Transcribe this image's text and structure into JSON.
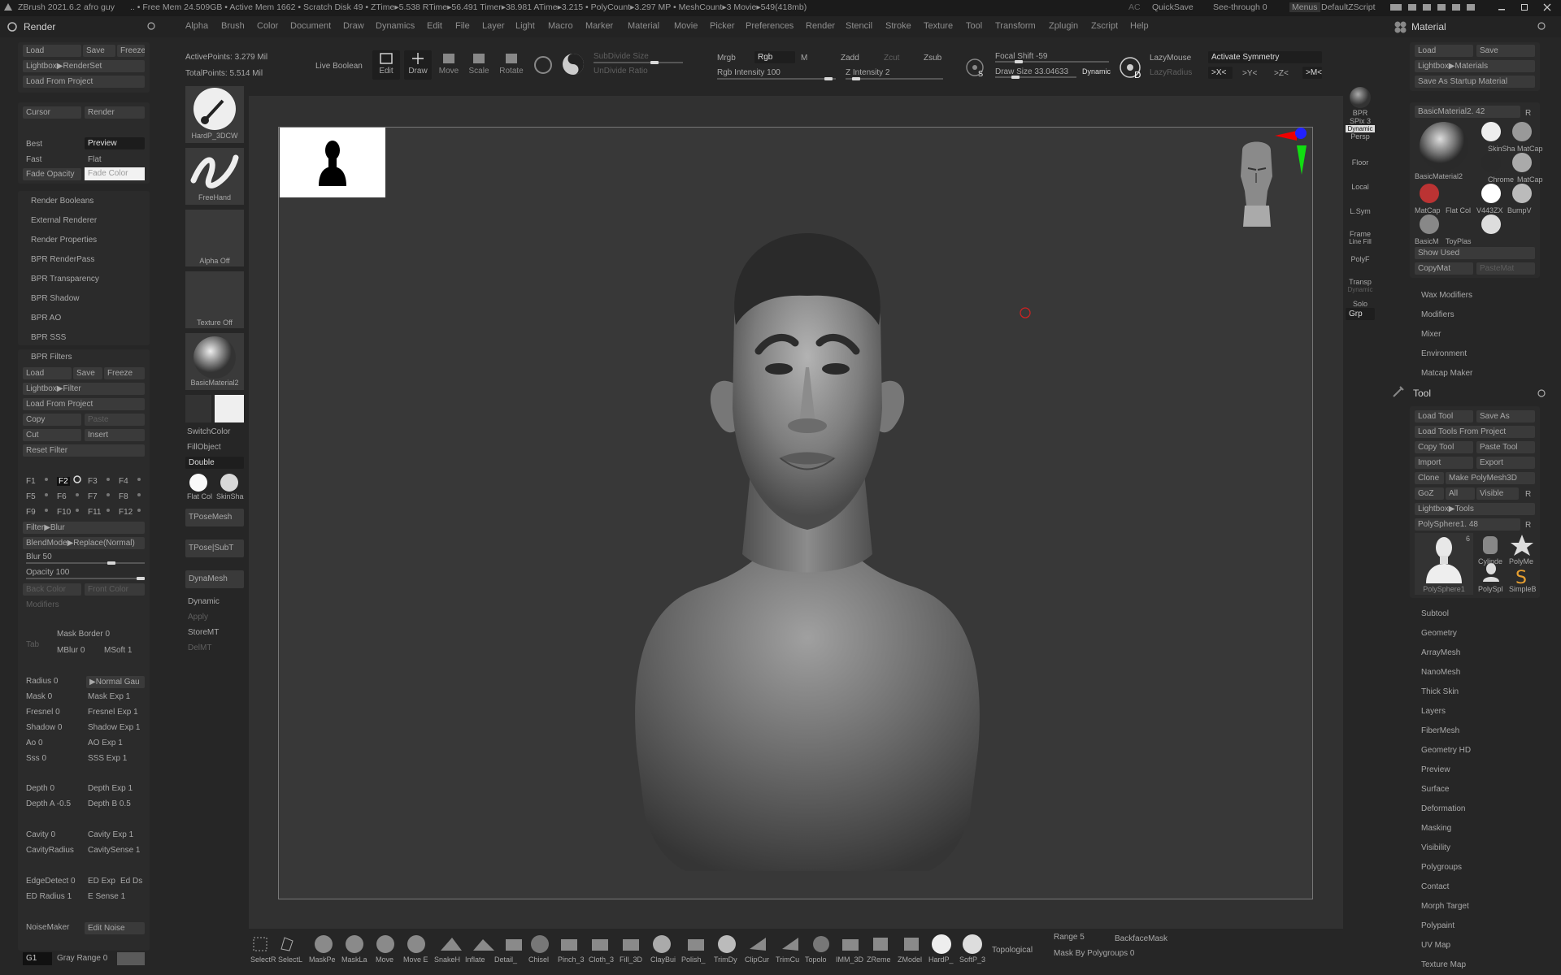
{
  "titlebar": {
    "app": "ZBrush 2021.6.2",
    "doc": "afro guy",
    "stats": ".. • Free Mem 24.509GB • Active Mem 1662 • Scratch Disk 49 • ZTime▸5.538 RTime▸56.491 Timer▸38.981 ATime▸3.215 • PolyCount▸3.297 MP • MeshCount▸3 Movie▸549(418mb)",
    "ac": "AC",
    "quicksave": "QuickSave",
    "seethrough": "See-through  0",
    "menus": "Menus",
    "script": "DefaultZScript"
  },
  "menus": [
    "Alpha",
    "Brush",
    "Color",
    "Document",
    "Draw",
    "Dynamics",
    "Edit",
    "File",
    "Layer",
    "Light",
    "Macro",
    "Marker",
    "Material",
    "Movie",
    "Picker",
    "Preferences",
    "Render",
    "Stencil",
    "Stroke",
    "Texture",
    "Tool",
    "Transform",
    "Zplugin",
    "Zscript",
    "Help"
  ],
  "left": {
    "title": "Render",
    "top_btns": [
      "Load",
      "Save",
      "Freeze"
    ],
    "lightbox": "Lightbox▶RenderSet",
    "loadproj": "Load From Project",
    "cursor": "Cursor",
    "render": "Render",
    "best": "Best",
    "preview": "Preview",
    "fast": "Fast",
    "flat": "Flat",
    "fade": "Fade Opacity",
    "fadecolor": "Fade Color",
    "subs": [
      "Render Booleans",
      "External Renderer",
      "Render Properties",
      "BPR RenderPass",
      "BPR Transparency",
      "BPR Shadow",
      "BPR AO",
      "BPR SSS"
    ],
    "filters_title": "BPR Filters",
    "f_btns": [
      "Load",
      "Save",
      "Freeze"
    ],
    "f_lightbox": "Lightbox▶Filter",
    "f_loadproj": "Load From Project",
    "copy": "Copy",
    "paste": "Paste",
    "cut": "Cut",
    "insert": "Insert",
    "reset": "Reset Filter",
    "fslots": [
      "F1",
      "F2",
      "F3",
      "F4",
      "F5",
      "F6",
      "F7",
      "F8",
      "F9",
      "F10",
      "F11",
      "F12"
    ],
    "filterblur": "Filter▶Blur",
    "blend": "BlendMode▶Replace(Normal)",
    "blur": "Blur 50",
    "opacity": "Opacity 100",
    "backcolor": "Back Color",
    "frontcolor": "Front Color",
    "modifiers": "Modifiers",
    "maskborder": "Mask Border 0",
    "mblur": "MBlur 0",
    "msoft": "MSoft 1",
    "tab": "Tab",
    "params": [
      [
        "Radius 0",
        "▶Normal Gau"
      ],
      [
        "Mask 0",
        "Mask Exp 1"
      ],
      [
        "Fresnel 0",
        "Fresnel Exp 1"
      ],
      [
        "Shadow 0",
        "Shadow Exp 1"
      ],
      [
        "Ao 0",
        "AO Exp 1"
      ],
      [
        "Sss 0",
        "SSS Exp 1"
      ]
    ],
    "params2": [
      [
        "Depth 0",
        "Depth Exp 1"
      ],
      [
        "Depth A -0.5",
        "Depth B 0.5"
      ]
    ],
    "params3": [
      [
        "Cavity 0",
        "Cavity Exp 1"
      ],
      [
        "CavityRadius",
        "CavitySense 1"
      ]
    ],
    "edge": [
      "EdgeDetect 0",
      "ED Exp",
      "Ed Ds"
    ],
    "edradius": "ED Radius 1",
    "esense": "E Sense 1",
    "noise": "NoiseMaker",
    "editnoise": "Edit Noise",
    "g1": "G1",
    "grayrange": "Gray Range 0"
  },
  "shelf": {
    "brush": "HardP_3DCW",
    "stroke": "FreeHand",
    "alpha": "Alpha Off",
    "texture": "Texture Off",
    "material": "BasicMaterial2",
    "switch": "SwitchColor",
    "fill": "FillObject",
    "double": "Double",
    "flat": "Flat Col",
    "skin": "SkinSha",
    "tpose": "TPoseMesh",
    "tposesub": "TPose|SubT",
    "dyna": "DynaMesh",
    "dynamic": "Dynamic",
    "apply": "Apply",
    "store": "StoreMT",
    "del": "DelMT"
  },
  "top": {
    "active": "ActivePoints: 3.279 Mil",
    "total": "TotalPoints: 5.514 Mil",
    "live": "Live Boolean",
    "edit": "Edit",
    "draw": "Draw",
    "move": "Move",
    "scale": "Scale",
    "rotate": "Rotate",
    "subdiv": "SubDivide Size",
    "undivide": "UnDivide Ratio",
    "mrgb": "Mrgb",
    "rgb": "Rgb",
    "m": "M",
    "rgbint": "Rgb Intensity 100",
    "zadd": "Zadd",
    "zcut": "Zcut",
    "zsub": "Zsub",
    "zint": "Z Intensity 2",
    "focal": "Focal Shift -59",
    "drawsize": "Draw Size 33.04633",
    "dynamicbtn": "Dynamic",
    "lazy": "LazyMouse",
    "lazyr": "LazyRadius",
    "sym": "Activate Symmetry",
    "x": ">X<",
    "y": ">Y<",
    "z": ">Z<",
    "mm": ">M<"
  },
  "rightdock": [
    "BPR",
    "SPix 3",
    "Dynamic",
    "Persp",
    "Floor",
    "Local",
    "L.Sym",
    "Frame",
    "Line Fill",
    "PolyF",
    "Transp",
    "Dynamic",
    "Solo",
    "Grp"
  ],
  "right": {
    "mat_title": "Material",
    "mat_btns": [
      "Load",
      "Save"
    ],
    "mat_lightbox": "Lightbox▶Materials",
    "mat_startup": "Save As Startup Material",
    "mat_current": "BasicMaterial2. 42",
    "r": "R",
    "mats": [
      "SkinSha",
      "MatCap",
      "Chrome",
      "MatCap",
      "MatCap",
      "Flat Col",
      "V443ZX",
      "BumpV",
      "BasicM",
      "ToyPlas"
    ],
    "showused": "Show Used",
    "copymat": "CopyMat",
    "pastemat": "PasteMat",
    "basicmat_lbl": "BasicMaterial2",
    "mat_subs": [
      "Wax Modifiers",
      "Modifiers",
      "Mixer",
      "Environment",
      "Matcap Maker"
    ],
    "tool_title": "Tool",
    "tool_rows": [
      [
        "Load Tool",
        "Save As"
      ],
      [
        "Load Tools From Project"
      ],
      [
        "Copy Tool",
        "Paste Tool"
      ],
      [
        "Import",
        "Export"
      ],
      [
        "Clone",
        "Make PolyMesh3D"
      ],
      [
        "GoZ",
        "All",
        "Visible",
        "R"
      ],
      [
        "Lightbox▶Tools"
      ]
    ],
    "tool_current": "PolySphere1. 48",
    "tools": [
      "PolySphere1",
      "Cylinde",
      "PolyMe",
      "PolySpl",
      "SimpleB"
    ],
    "tool_badge": "6",
    "tool_subs": [
      "Subtool",
      "Geometry",
      "ArrayMesh",
      "NanoMesh",
      "Thick Skin",
      "Layers",
      "FiberMesh",
      "Geometry HD",
      "Preview",
      "Surface",
      "Deformation",
      "Masking",
      "Visibility",
      "Polygroups",
      "Contact",
      "Morph Target",
      "Polypaint",
      "UV Map",
      "Texture Map"
    ]
  },
  "bottom": {
    "brushes": [
      "SelectR",
      "SelectL",
      "MaskPe",
      "MaskLa",
      "Move",
      "Move E",
      "SnakeH",
      "Inflate",
      "Detail_",
      "Chisel",
      "Pinch_3",
      "Cloth_3",
      "Fill_3D",
      "ClayBui",
      "Polish_",
      "TrimDy",
      "ClipCur",
      "TrimCu",
      "Topolo",
      "IMM_3D",
      "ZReme",
      "ZModel",
      "HardP_",
      "SoftP_3"
    ],
    "topological": "Topological",
    "range": "Range 5",
    "backface": "BackfaceMask",
    "maskpoly": "Mask By Polygroups 0"
  }
}
